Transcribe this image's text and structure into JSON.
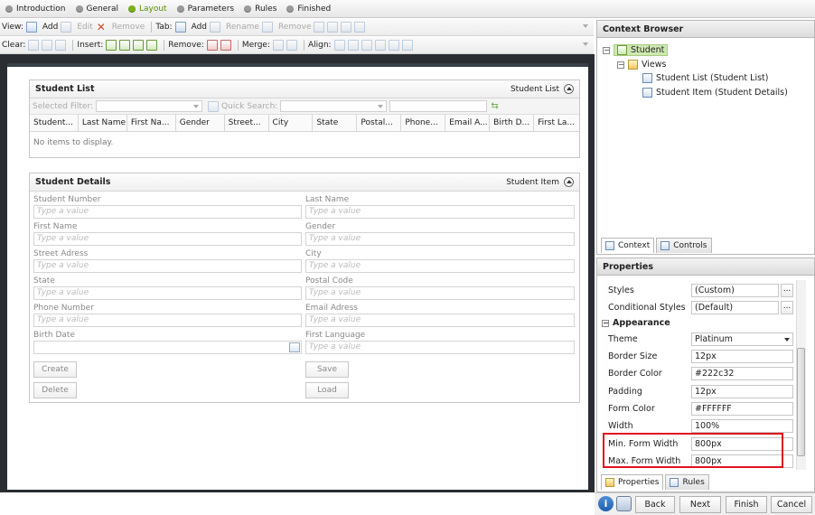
{
  "wizard": {
    "steps": [
      {
        "label": "Introduction",
        "active": false
      },
      {
        "label": "General",
        "active": false
      },
      {
        "label": "Layout",
        "active": true
      },
      {
        "label": "Parameters",
        "active": false
      },
      {
        "label": "Rules",
        "active": false
      },
      {
        "label": "Finished",
        "active": false
      }
    ]
  },
  "toolbar1": {
    "view_label": "View:",
    "add": "Add",
    "edit": "Edit",
    "remove": "Remove",
    "tab_label": "Tab:",
    "tab_add": "Add",
    "rename": "Rename",
    "tab_remove": "Remove"
  },
  "toolbar2": {
    "clear_label": "Clear:",
    "insert_label": "Insert:",
    "remove_label": "Remove:",
    "merge_label": "Merge:",
    "align_label": "Align:"
  },
  "student_list": {
    "title": "Student List",
    "view_name": "Student List",
    "selected_filter": "Selected Filter:",
    "quick_search": "Quick Search:",
    "columns": [
      "Student...",
      "Last Name",
      "First Na...",
      "Gender",
      "Street...",
      "City",
      "State",
      "Postal...",
      "Phone...",
      "Email A...",
      "Birth D...",
      "First La..."
    ],
    "empty": "No items to display."
  },
  "student_details": {
    "title": "Student Details",
    "view_name": "Student Item",
    "placeholder": "Type a value",
    "fields_left": [
      "Student Number",
      "First Name",
      "Street Adress",
      "State",
      "Phone Number",
      "Birth Date"
    ],
    "fields_right": [
      "Last Name",
      "Gender",
      "City",
      "Postal Code",
      "Email Adress",
      "First Language"
    ],
    "buttons": {
      "create": "Create",
      "delete": "Delete",
      "save": "Save",
      "load": "Load"
    }
  },
  "context_browser": {
    "title": "Context Browser",
    "root": "Student",
    "views": "Views",
    "items": [
      "Student List (Student List)",
      "Student Item (Student Details)"
    ],
    "tabs": [
      "Context",
      "Controls"
    ]
  },
  "properties": {
    "title": "Properties",
    "rows_top": [
      {
        "key": "Styles",
        "value": "(Custom)"
      },
      {
        "key": "Conditional Styles",
        "value": "(Default)"
      }
    ],
    "category": "Appearance",
    "rows": [
      {
        "key": "Theme",
        "value": "Platinum"
      },
      {
        "key": "Border Size",
        "value": "12px"
      },
      {
        "key": "Border Color",
        "value": "#222c32"
      },
      {
        "key": "Padding",
        "value": "12px"
      },
      {
        "key": "Form Color",
        "value": "#FFFFFF"
      },
      {
        "key": "Width",
        "value": "100%"
      },
      {
        "key": "Min. Form Width",
        "value": "800px"
      },
      {
        "key": "Max. Form Width",
        "value": "800px"
      }
    ],
    "tabs": [
      "Properties",
      "Rules"
    ]
  },
  "footer": {
    "back": "Back",
    "next": "Next",
    "finish": "Finish",
    "cancel": "Cancel"
  }
}
